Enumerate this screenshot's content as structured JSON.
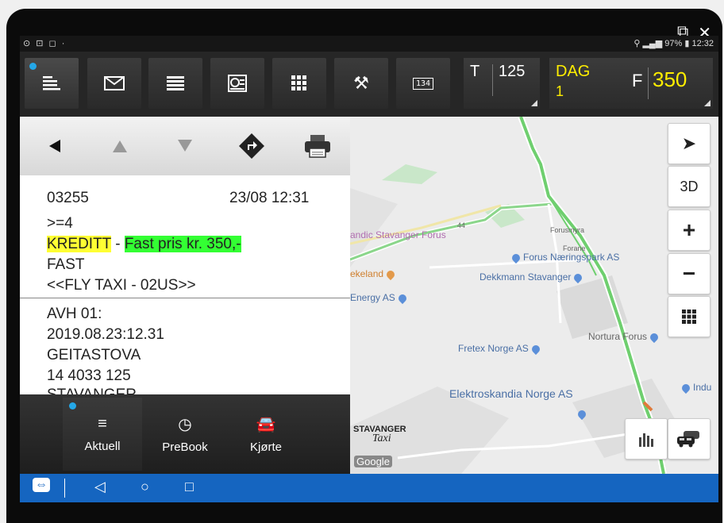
{
  "window_icons": {
    "popout": "popout-icon",
    "close": "close-icon"
  },
  "status_bar": {
    "left_icons": "⊙ ⊡ ◻ ·",
    "right": "97%",
    "time": "12:32"
  },
  "toolbar": {
    "tiles": [
      "list-icon",
      "mail-icon",
      "menu-icon",
      "taximeter-icon",
      "grid-icon",
      "tools-icon",
      "display-icon"
    ],
    "display_label": "134",
    "counter_t": {
      "label": "T",
      "value": "125"
    },
    "counter_dag": {
      "label": "DAG",
      "sub": "1",
      "f_label": "F",
      "f_value": "350"
    }
  },
  "job": {
    "id": "03255",
    "datetime": "23/08 12:31",
    "passengers": ">=4",
    "payment": "KREDITT",
    "separator": "-",
    "price": "Fast pris kr. 350,-",
    "type": "FAST",
    "note": "<<FLY  TAXI  - 02US>>",
    "pickup_label": "AVH 01:",
    "pickup_time": "2019.08.23:12.31",
    "street": "GEITASTOVA",
    "address_no": "14  4033  125",
    "city": "STAVANGER"
  },
  "bottom_nav": {
    "tabs": [
      {
        "label": "Aktuell"
      },
      {
        "label": "PreBook"
      },
      {
        "label": "Kjørte"
      }
    ]
  },
  "map": {
    "three_d": "3D",
    "zoom_in": "+",
    "zoom_out": "−",
    "places": {
      "stavanger_forus": "andic Stavanger Forus",
      "forus_naeringspark": "Forus Næringspark AS",
      "forusmyra": "Forusmyra",
      "forane": "Forane",
      "ekeland": "ekeland",
      "dekkmann": "Dekkmann Stavanger",
      "energy": "Energy AS",
      "nortura": "Nortura Forus",
      "fretex": "Fretex Norge AS",
      "elektroskandia": "Elektroskandia Norge AS",
      "indu": "Indu",
      "road_44": "44"
    },
    "brand_line1": "STAVANGER",
    "brand_line2": "Taxi",
    "google": "Google"
  }
}
